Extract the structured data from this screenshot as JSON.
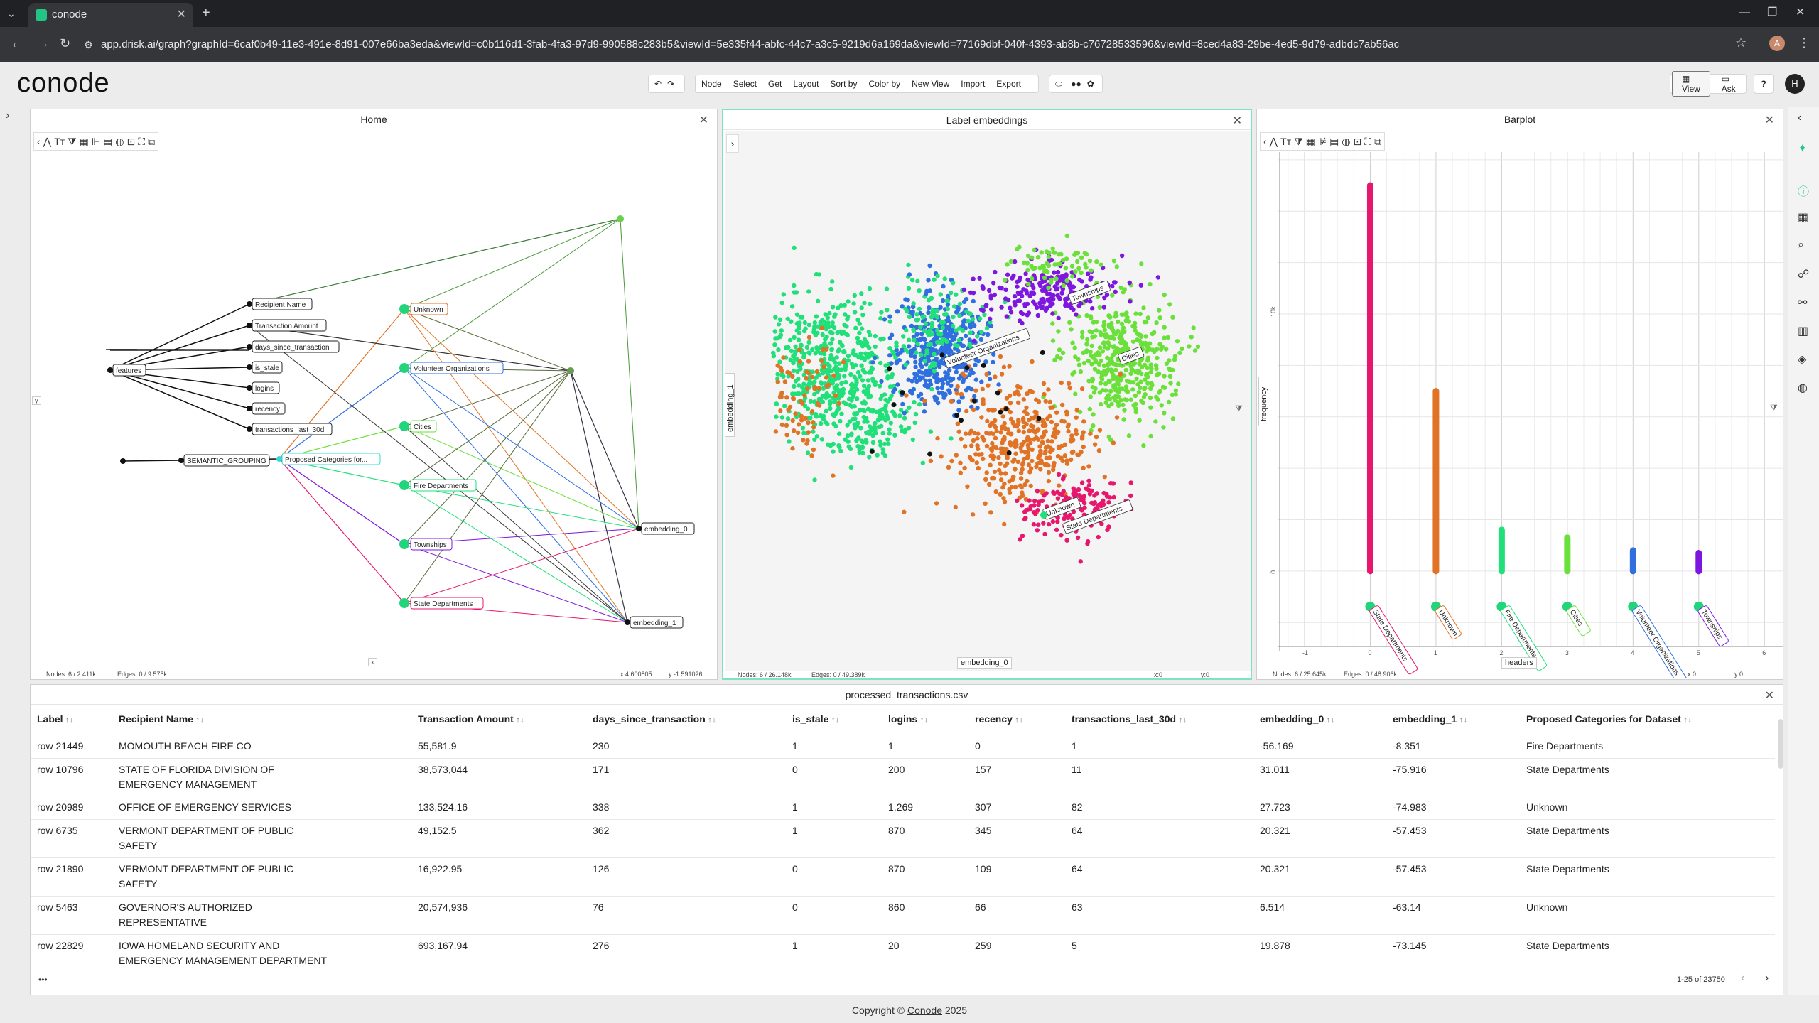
{
  "browser": {
    "tab_title": "conode",
    "url": "app.drisk.ai/graph?graphId=6caf0b49-11e3-491e-8d91-007e66ba3eda&viewId=c0b116d1-3fab-4fa3-97d9-990588c283b5&viewId=5e335f44-abfc-44c7-a3c5-9219d6a169da&viewId=77169dbf-040f-4393-ab8b-c76728533596&viewId=8ced4a83-29be-4ed5-9d79-adbdc7ab56ac",
    "avatar_letter": "A"
  },
  "app": {
    "logo": "conode",
    "toolbar": [
      "Node",
      "Select",
      "Get",
      "Layout",
      "Sort by",
      "Color by",
      "New View",
      "Import",
      "Export"
    ],
    "view_label": "View",
    "ask_label": "Ask",
    "help": "?",
    "user_initial": "H"
  },
  "home_panel": {
    "title": "Home",
    "y_btn": "y",
    "x_btn": "x",
    "nodes_stat": "Nodes: 6 / 2.411k",
    "edges_stat": "Edges: 0 / 9.575k",
    "coord_x": "x:4.600805",
    "coord_y": "y:-1.591026",
    "nodes": {
      "features": "features",
      "recipient_name": "Recipient Name",
      "transaction_amount": "Transaction Amount",
      "days_since_transaction": "days_since_transaction",
      "is_stale": "is_stale",
      "logins": "logins",
      "recency": "recency",
      "transactions_last_30d": "transactions_last_30d",
      "semantic_grouping": "SEMANTIC_GROUPING",
      "proposed_categories": "Proposed Categories for...",
      "unknown": "Unknown",
      "volunteer": "Volunteer Organizations",
      "cities": "Cities",
      "fire": "Fire Departments",
      "townships": "Townships",
      "state": "State Departments",
      "embedding_0": "embedding_0",
      "embedding_1": "embedding_1"
    }
  },
  "embed_panel": {
    "title": "Label embeddings",
    "x_axis": "embedding_0",
    "y_axis": "embedding_1",
    "nodes_stat": "Nodes: 6 / 26.148k",
    "edges_stat": "Edges: 0 / 49.389k",
    "coord_x": "x:0",
    "coord_y": "y:0",
    "labels": {
      "townships": "Townships",
      "volunteer": "Volunteer Organizations",
      "cities": "Cities",
      "unknown": "Unknown",
      "state": "State Departments"
    }
  },
  "bar_panel": {
    "title": "Barplot",
    "x_axis": "headers",
    "y_axis": "frequency",
    "nodes_stat": "Nodes: 6 / 25.645k",
    "edges_stat": "Edges: 0 / 48.906k",
    "coord_x": "x:0",
    "coord_y": "y:0"
  },
  "chart_data": {
    "type": "bar",
    "categories": [
      "State Departments",
      "Unknown",
      "Fire Departments",
      "Cities",
      "Volunteer Organizations",
      "Townships"
    ],
    "x": [
      0,
      1,
      2,
      3,
      4,
      5
    ],
    "values": [
      15000,
      7000,
      1600,
      1300,
      800,
      700
    ],
    "colors": [
      "#e6176c",
      "#e07325",
      "#21e07a",
      "#6be03a",
      "#2f6fe0",
      "#7d17e0"
    ],
    "xlabel": "headers",
    "ylabel": "frequency",
    "x_ticks": [
      "-1",
      "0",
      "1",
      "2",
      "3",
      "4",
      "5",
      "6"
    ],
    "y_ticks": [
      "0",
      "10k"
    ],
    "xlim": [
      -1.4,
      6.3
    ],
    "ylim": [
      -3100,
      16300
    ],
    "grid": true
  },
  "table": {
    "title": "processed_transactions.csv",
    "columns": [
      "Label",
      "Recipient Name",
      "Transaction Amount",
      "days_since_transaction",
      "is_stale",
      "logins",
      "recency",
      "transactions_last_30d",
      "embedding_0",
      "embedding_1",
      "Proposed Categories for Dataset"
    ],
    "rows": [
      [
        "row 21449",
        "MOMOUTH BEACH FIRE CO",
        "",
        "55,581.9",
        "230",
        "1",
        "1",
        "0",
        "1",
        "-56.169",
        "-8.351",
        "Fire Departments"
      ],
      [
        "row 10796",
        "STATE OF FLORIDA DIVISION OF",
        "EMERGENCY MANAGEMENT",
        "38,573,044",
        "171",
        "0",
        "200",
        "157",
        "11",
        "31.011",
        "-75.916",
        "State Departments"
      ],
      [
        "row 20989",
        "OFFICE OF EMERGENCY SERVICES",
        "",
        "133,524.16",
        "338",
        "1",
        "1,269",
        "307",
        "82",
        "27.723",
        "-74.983",
        "Unknown"
      ],
      [
        "row 6735",
        "VERMONT DEPARTMENT OF PUBLIC",
        "SAFETY",
        "49,152.5",
        "362",
        "1",
        "870",
        "345",
        "64",
        "20.321",
        "-57.453",
        "State Departments"
      ],
      [
        "row 21890",
        "VERMONT DEPARTMENT OF PUBLIC",
        "SAFETY",
        "16,922.95",
        "126",
        "0",
        "870",
        "109",
        "64",
        "20.321",
        "-57.453",
        "State Departments"
      ],
      [
        "row 5463",
        "GOVERNOR'S AUTHORIZED",
        "REPRESENTATIVE",
        "20,574,936",
        "76",
        "0",
        "860",
        "66",
        "63",
        "6.514",
        "-63.14",
        "Unknown"
      ],
      [
        "row 22829",
        "IOWA HOMELAND SECURITY AND",
        "EMERGENCY MANAGEMENT DEPARTMENT",
        "693,167.94",
        "276",
        "1",
        "20",
        "259",
        "5",
        "19.878",
        "-73.145",
        "State Departments"
      ]
    ],
    "more": "•••",
    "pagination": "1-25 of 23750"
  },
  "footer": {
    "prefix": "Copyright ©",
    "link": "Conode",
    "year": "2025"
  }
}
